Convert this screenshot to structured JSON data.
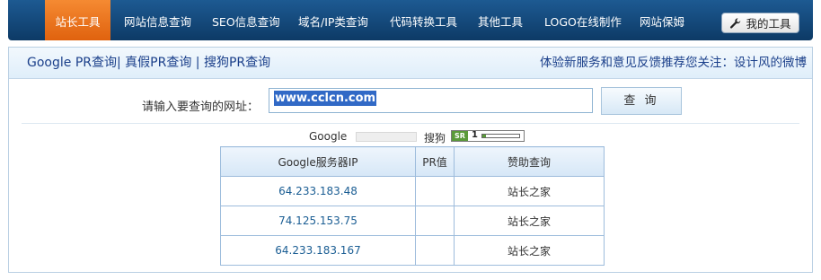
{
  "nav": {
    "items": [
      {
        "label": "站长工具",
        "active": true
      },
      {
        "label": "网站信息查询",
        "active": false
      },
      {
        "label": "SEO信息查询",
        "active": false
      },
      {
        "label": "域名/IP类查询",
        "active": false
      },
      {
        "label": "代码转换工具",
        "active": false
      },
      {
        "label": "其他工具",
        "active": false
      },
      {
        "label": "LOGO在线制作",
        "active": false
      },
      {
        "label": "网站保姆",
        "active": false
      }
    ],
    "my_tools": {
      "label": "我的工具",
      "icon": "wrench-icon"
    }
  },
  "subbar": {
    "links": [
      "Google PR查询",
      "真假PR查询",
      "搜狗PR查询"
    ],
    "separator": "|",
    "notice": "体验新服务和意见反馈推荐您关注：设计风的微博"
  },
  "query": {
    "label": "请输入要查询的网址：",
    "value": "www.cclcn.com",
    "button": "查 询"
  },
  "rank": {
    "google_label": "Google",
    "google_pr_fraction": 0,
    "sogou_label": "搜狗",
    "sr_badge": "SR",
    "sogou_rank": "1",
    "sogou_rank_fraction": 0.1
  },
  "table": {
    "headers": [
      "Google服务器IP",
      "PR值",
      "赞助查询"
    ],
    "rows": [
      {
        "ip": "64.233.183.48",
        "pr": "",
        "sponsor": "站长之家"
      },
      {
        "ip": "74.125.153.75",
        "pr": "",
        "sponsor": "站长之家"
      },
      {
        "ip": "64.233.183.167",
        "pr": "",
        "sponsor": "站长之家"
      }
    ]
  },
  "colors": {
    "nav_bg": "#13497c",
    "nav_active": "#ec7420",
    "link_blue": "#1a3f8a",
    "ip_blue": "#1a5d93",
    "selection": "#3169c6"
  }
}
